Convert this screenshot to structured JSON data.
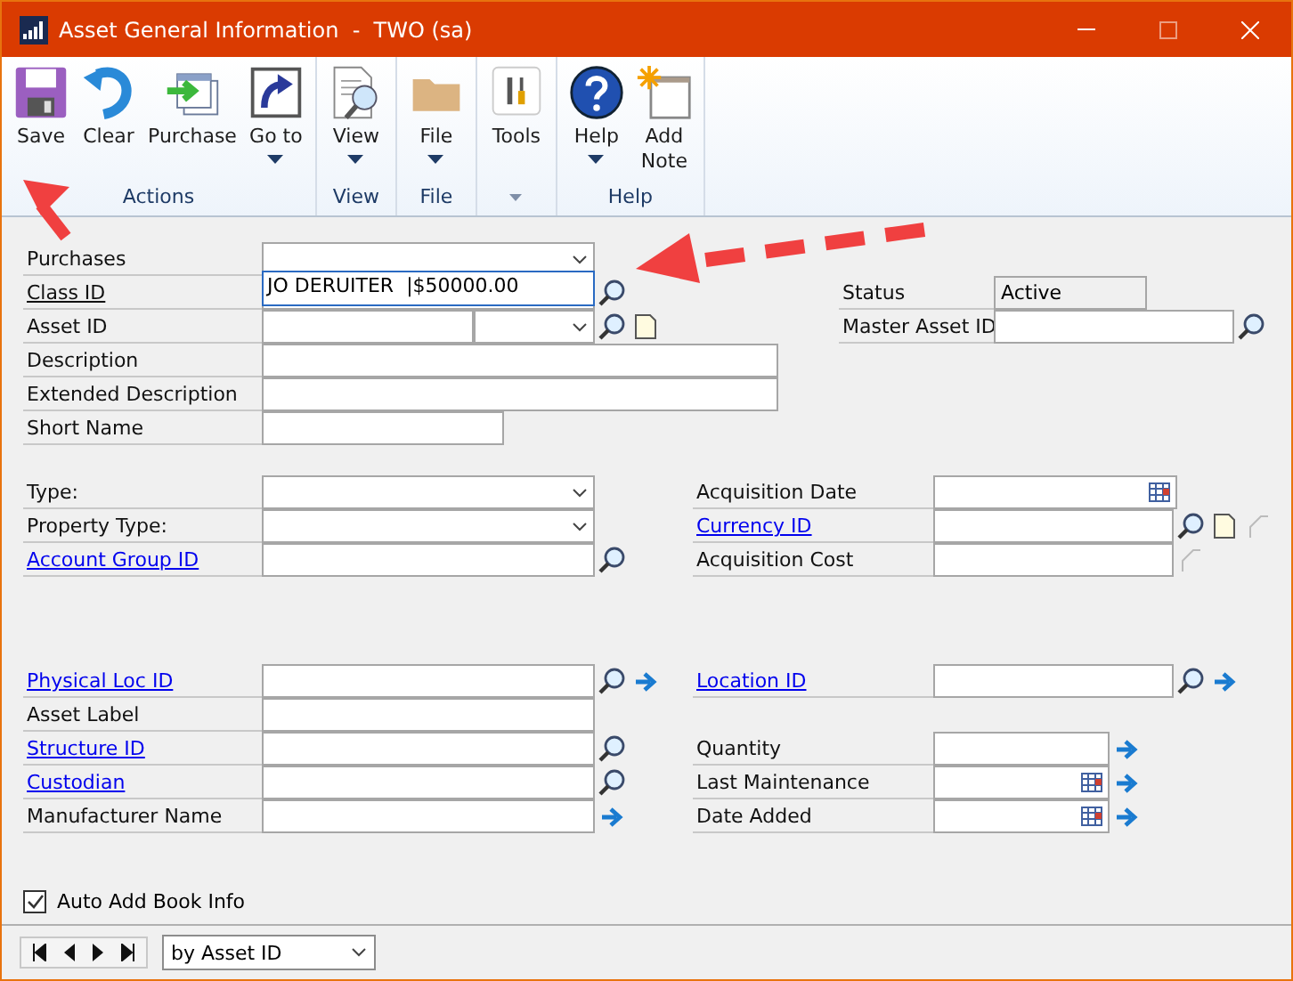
{
  "window": {
    "title": "Asset General Information  -  TWO (sa)"
  },
  "ribbon": {
    "groups": [
      {
        "label": "Actions",
        "buttons": [
          {
            "label": "Save",
            "menu": false
          },
          {
            "label": "Clear",
            "menu": false
          },
          {
            "label": "Purchase",
            "menu": false
          },
          {
            "label": "Go to",
            "menu": true
          }
        ]
      },
      {
        "label": "View",
        "buttons": [
          {
            "label": "View",
            "menu": true
          }
        ]
      },
      {
        "label": "File",
        "buttons": [
          {
            "label": "File",
            "menu": true
          }
        ]
      },
      {
        "launcher": true,
        "buttons": [
          {
            "label": "Tools",
            "menu": false
          }
        ]
      },
      {
        "label": "Help",
        "buttons": [
          {
            "label": "Help",
            "menu": true
          },
          {
            "label": "Add Note",
            "menu": false
          }
        ]
      }
    ]
  },
  "form": {
    "left": [
      {
        "label": "Purchases",
        "link": false,
        "underlined": false,
        "kind": "combo"
      },
      {
        "label": "Class ID",
        "link": false,
        "underlined": true,
        "kind": "text",
        "tools": [
          {
            "kind": "lookup"
          }
        ]
      },
      {
        "label": "Asset ID",
        "link": false,
        "underlined": false,
        "kind": "split",
        "tools": [
          {
            "kind": "lookup"
          },
          {
            "kind": "note"
          }
        ]
      },
      {
        "label": "Description",
        "link": false,
        "underlined": false,
        "kind": "text"
      },
      {
        "label": "Extended Description",
        "link": false,
        "underlined": false,
        "kind": "text"
      },
      {
        "label": "Short Name",
        "link": false,
        "underlined": false,
        "kind": "text"
      },
      {
        "label": "Type:",
        "link": false,
        "underlined": false,
        "kind": "combo"
      },
      {
        "label": "Property Type:",
        "link": false,
        "underlined": false,
        "kind": "combo"
      },
      {
        "label": "Account Group ID",
        "link": true,
        "underlined": true,
        "kind": "text",
        "tools": [
          {
            "kind": "lookup"
          }
        ]
      },
      {
        "label": "Physical Loc ID",
        "link": true,
        "underlined": true,
        "kind": "text",
        "tools": [
          {
            "kind": "lookup"
          },
          {
            "kind": "arrow"
          }
        ]
      },
      {
        "label": "Asset Label",
        "link": false,
        "underlined": false,
        "kind": "text"
      },
      {
        "label": "Structure ID",
        "link": true,
        "underlined": true,
        "kind": "text",
        "tools": [
          {
            "kind": "lookup"
          }
        ]
      },
      {
        "label": "Custodian",
        "link": true,
        "underlined": true,
        "kind": "text",
        "tools": [
          {
            "kind": "lookup"
          }
        ]
      },
      {
        "label": "Manufacturer Name",
        "link": false,
        "underlined": false,
        "kind": "text",
        "tools": [
          {
            "kind": "arrow"
          }
        ]
      }
    ],
    "right": [
      {
        "label": "Status",
        "link": false,
        "underlined": false,
        "kind": "readonly",
        "value": "Active"
      },
      {
        "label": "Master Asset ID",
        "link": false,
        "underlined": false,
        "kind": "text",
        "tools": [
          {
            "kind": "lookup"
          }
        ]
      },
      {
        "label": "Acquisition Date",
        "link": false,
        "underlined": false,
        "kind": "date"
      },
      {
        "label": "Currency ID",
        "link": true,
        "underlined": true,
        "kind": "text",
        "tools": [
          {
            "kind": "lookup"
          },
          {
            "kind": "note"
          },
          {
            "kind": "expand"
          }
        ]
      },
      {
        "label": "Acquisition Cost",
        "link": false,
        "underlined": false,
        "kind": "text",
        "tools": [
          {
            "kind": "expand"
          }
        ]
      },
      {
        "label": "Location ID",
        "link": true,
        "underlined": true,
        "kind": "text",
        "tools": [
          {
            "kind": "lookup"
          },
          {
            "kind": "arrow"
          }
        ]
      },
      {
        "label": "Quantity",
        "link": false,
        "underlined": false,
        "kind": "text",
        "tools": [
          {
            "kind": "arrow"
          }
        ]
      },
      {
        "label": "Last Maintenance",
        "link": false,
        "underlined": false,
        "kind": "date",
        "tools": [
          {
            "kind": "arrow"
          }
        ]
      },
      {
        "label": "Date Added",
        "link": false,
        "underlined": false,
        "kind": "date",
        "tools": [
          {
            "kind": "arrow"
          }
        ]
      }
    ],
    "dropdown": {
      "option": "JO DERUITER  |$50000.00"
    },
    "auto_add": {
      "label": "Auto Add Book Info",
      "checked": true
    }
  },
  "footer": {
    "sort": "by Asset ID"
  }
}
